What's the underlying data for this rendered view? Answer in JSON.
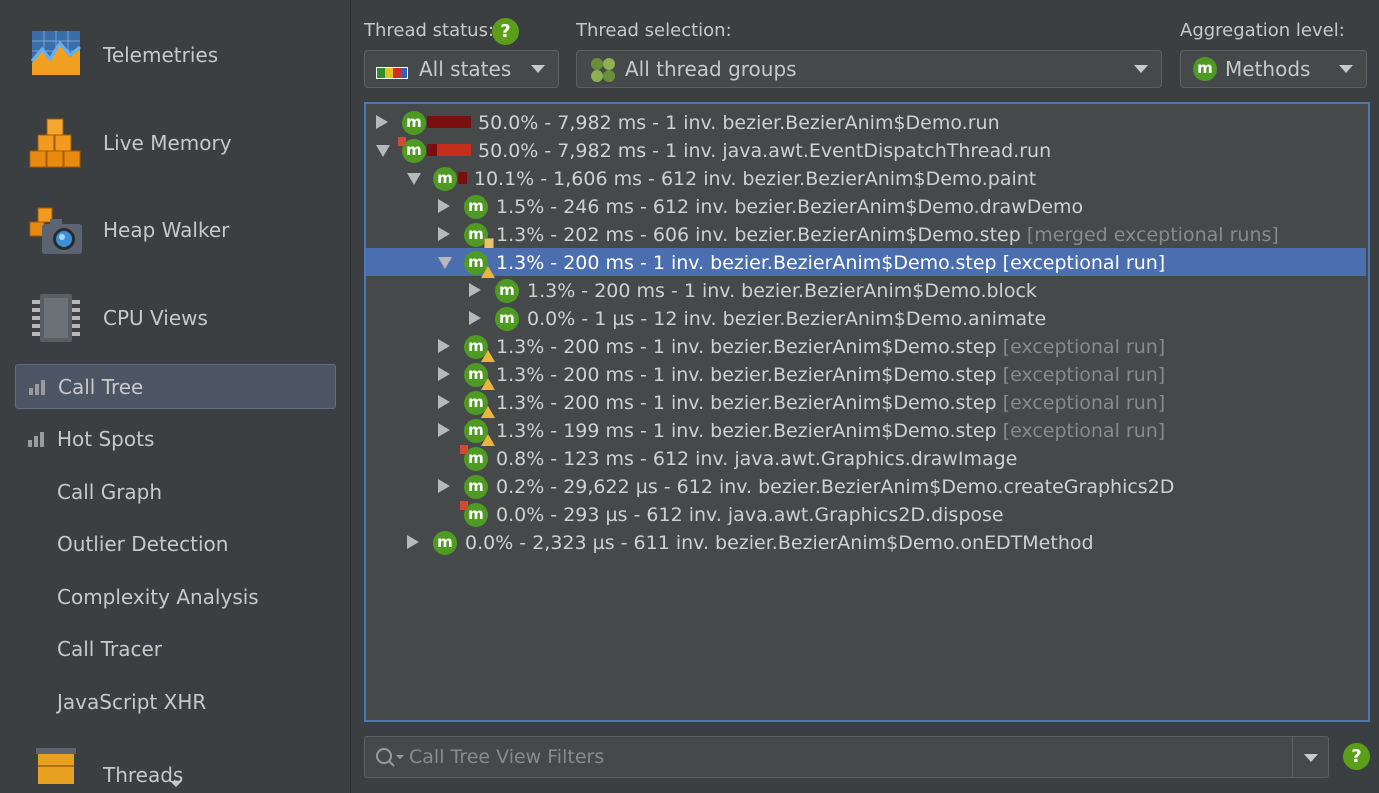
{
  "sidebar": {
    "big_items": [
      {
        "label": "Telemetries",
        "icon": "telemetries-icon"
      },
      {
        "label": "Live Memory",
        "icon": "live-memory-icon"
      },
      {
        "label": "Heap Walker",
        "icon": "heap-walker-icon"
      },
      {
        "label": "CPU Views",
        "icon": "cpu-views-icon"
      }
    ],
    "sub_items": [
      {
        "label": "Call Tree",
        "selected": true
      },
      {
        "label": "Hot Spots"
      },
      {
        "label": "Call Graph"
      },
      {
        "label": "Outlier Detection"
      },
      {
        "label": "Complexity Analysis"
      },
      {
        "label": "Call Tracer"
      },
      {
        "label": "JavaScript XHR"
      }
    ],
    "threads_label": "Threads"
  },
  "toolbar": {
    "thread_status_label": "Thread status:",
    "thread_status_value": "All states",
    "thread_selection_label": "Thread selection:",
    "thread_selection_value": "All thread groups",
    "aggregation_label": "Aggregation level:",
    "aggregation_value": "Methods",
    "help_glyph": "?",
    "method_glyph": "m"
  },
  "tree": {
    "rows": [
      {
        "depth": 0,
        "state": "collapsed",
        "icon": "method-icon",
        "bar": 0.5,
        "text": "50.0% - 7,982 ms - 1 inv. bezier.BezierAnim$Demo.run",
        "extra": ""
      },
      {
        "depth": 0,
        "state": "expanded",
        "icon": "method-icon",
        "corner": true,
        "bar": 0.5,
        "text": "50.0% - 7,982 ms - 1 inv. java.awt.EventDispatchThread.run",
        "extra": ""
      },
      {
        "depth": 1,
        "state": "expanded",
        "icon": "method-icon",
        "bar": 0.101,
        "text": "10.1% - 1,606 ms - 612 inv. bezier.BezierAnim$Demo.paint",
        "extra": ""
      },
      {
        "depth": 2,
        "state": "collapsed",
        "icon": "method-icon",
        "text": "1.5% - 246 ms - 612 inv. bezier.BezierAnim$Demo.drawDemo",
        "extra": ""
      },
      {
        "depth": 2,
        "state": "collapsed",
        "icon": "method-icon",
        "merged": true,
        "text": "1.3% - 202 ms - 606 inv. bezier.BezierAnim$Demo.step",
        "extra": "[merged exceptional runs]"
      },
      {
        "depth": 2,
        "state": "expanded",
        "icon": "method-icon",
        "warn": true,
        "selected": true,
        "text": "1.3% - 200 ms - 1 inv. bezier.BezierAnim$Demo.step",
        "extra": "[exceptional run]"
      },
      {
        "depth": 3,
        "state": "collapsed",
        "icon": "method-icon",
        "text": "1.3% - 200 ms - 1 inv. bezier.BezierAnim$Demo.block",
        "extra": ""
      },
      {
        "depth": 3,
        "state": "collapsed",
        "icon": "method-icon",
        "text": "0.0% - 1 µs - 12 inv. bezier.BezierAnim$Demo.animate",
        "extra": ""
      },
      {
        "depth": 2,
        "state": "collapsed",
        "icon": "method-icon",
        "warn": true,
        "text": "1.3% - 200 ms - 1 inv. bezier.BezierAnim$Demo.step",
        "extra": "[exceptional run]"
      },
      {
        "depth": 2,
        "state": "collapsed",
        "icon": "method-icon",
        "warn": true,
        "text": "1.3% - 200 ms - 1 inv. bezier.BezierAnim$Demo.step",
        "extra": "[exceptional run]"
      },
      {
        "depth": 2,
        "state": "collapsed",
        "icon": "method-icon",
        "warn": true,
        "text": "1.3% - 200 ms - 1 inv. bezier.BezierAnim$Demo.step",
        "extra": "[exceptional run]"
      },
      {
        "depth": 2,
        "state": "collapsed",
        "icon": "method-icon",
        "warn": true,
        "text": "1.3% - 199 ms - 1 inv. bezier.BezierAnim$Demo.step",
        "extra": "[exceptional run]"
      },
      {
        "depth": 2,
        "state": "leaf",
        "icon": "method-icon",
        "corner": true,
        "text": "0.8% - 123 ms - 612 inv. java.awt.Graphics.drawImage",
        "extra": ""
      },
      {
        "depth": 2,
        "state": "collapsed",
        "icon": "method-icon",
        "text": "0.2% - 29,622 µs - 612 inv. bezier.BezierAnim$Demo.createGraphics2D",
        "extra": ""
      },
      {
        "depth": 2,
        "state": "leaf",
        "icon": "method-icon",
        "corner": true,
        "text": "0.0% - 293 µs - 612 inv. java.awt.Graphics2D.dispose",
        "extra": ""
      },
      {
        "depth": 1,
        "state": "collapsed",
        "icon": "method-icon",
        "text": "0.0% - 2,323 µs - 611 inv. bezier.BezierAnim$Demo.onEDTMethod",
        "extra": ""
      }
    ]
  },
  "filter": {
    "placeholder": "Call Tree View Filters"
  },
  "colors": {
    "accent": "#4b6eaf",
    "method_icon": "#4f9a22",
    "bar_dark": "#7a0f0f",
    "bar_red": "#c42e1c"
  }
}
